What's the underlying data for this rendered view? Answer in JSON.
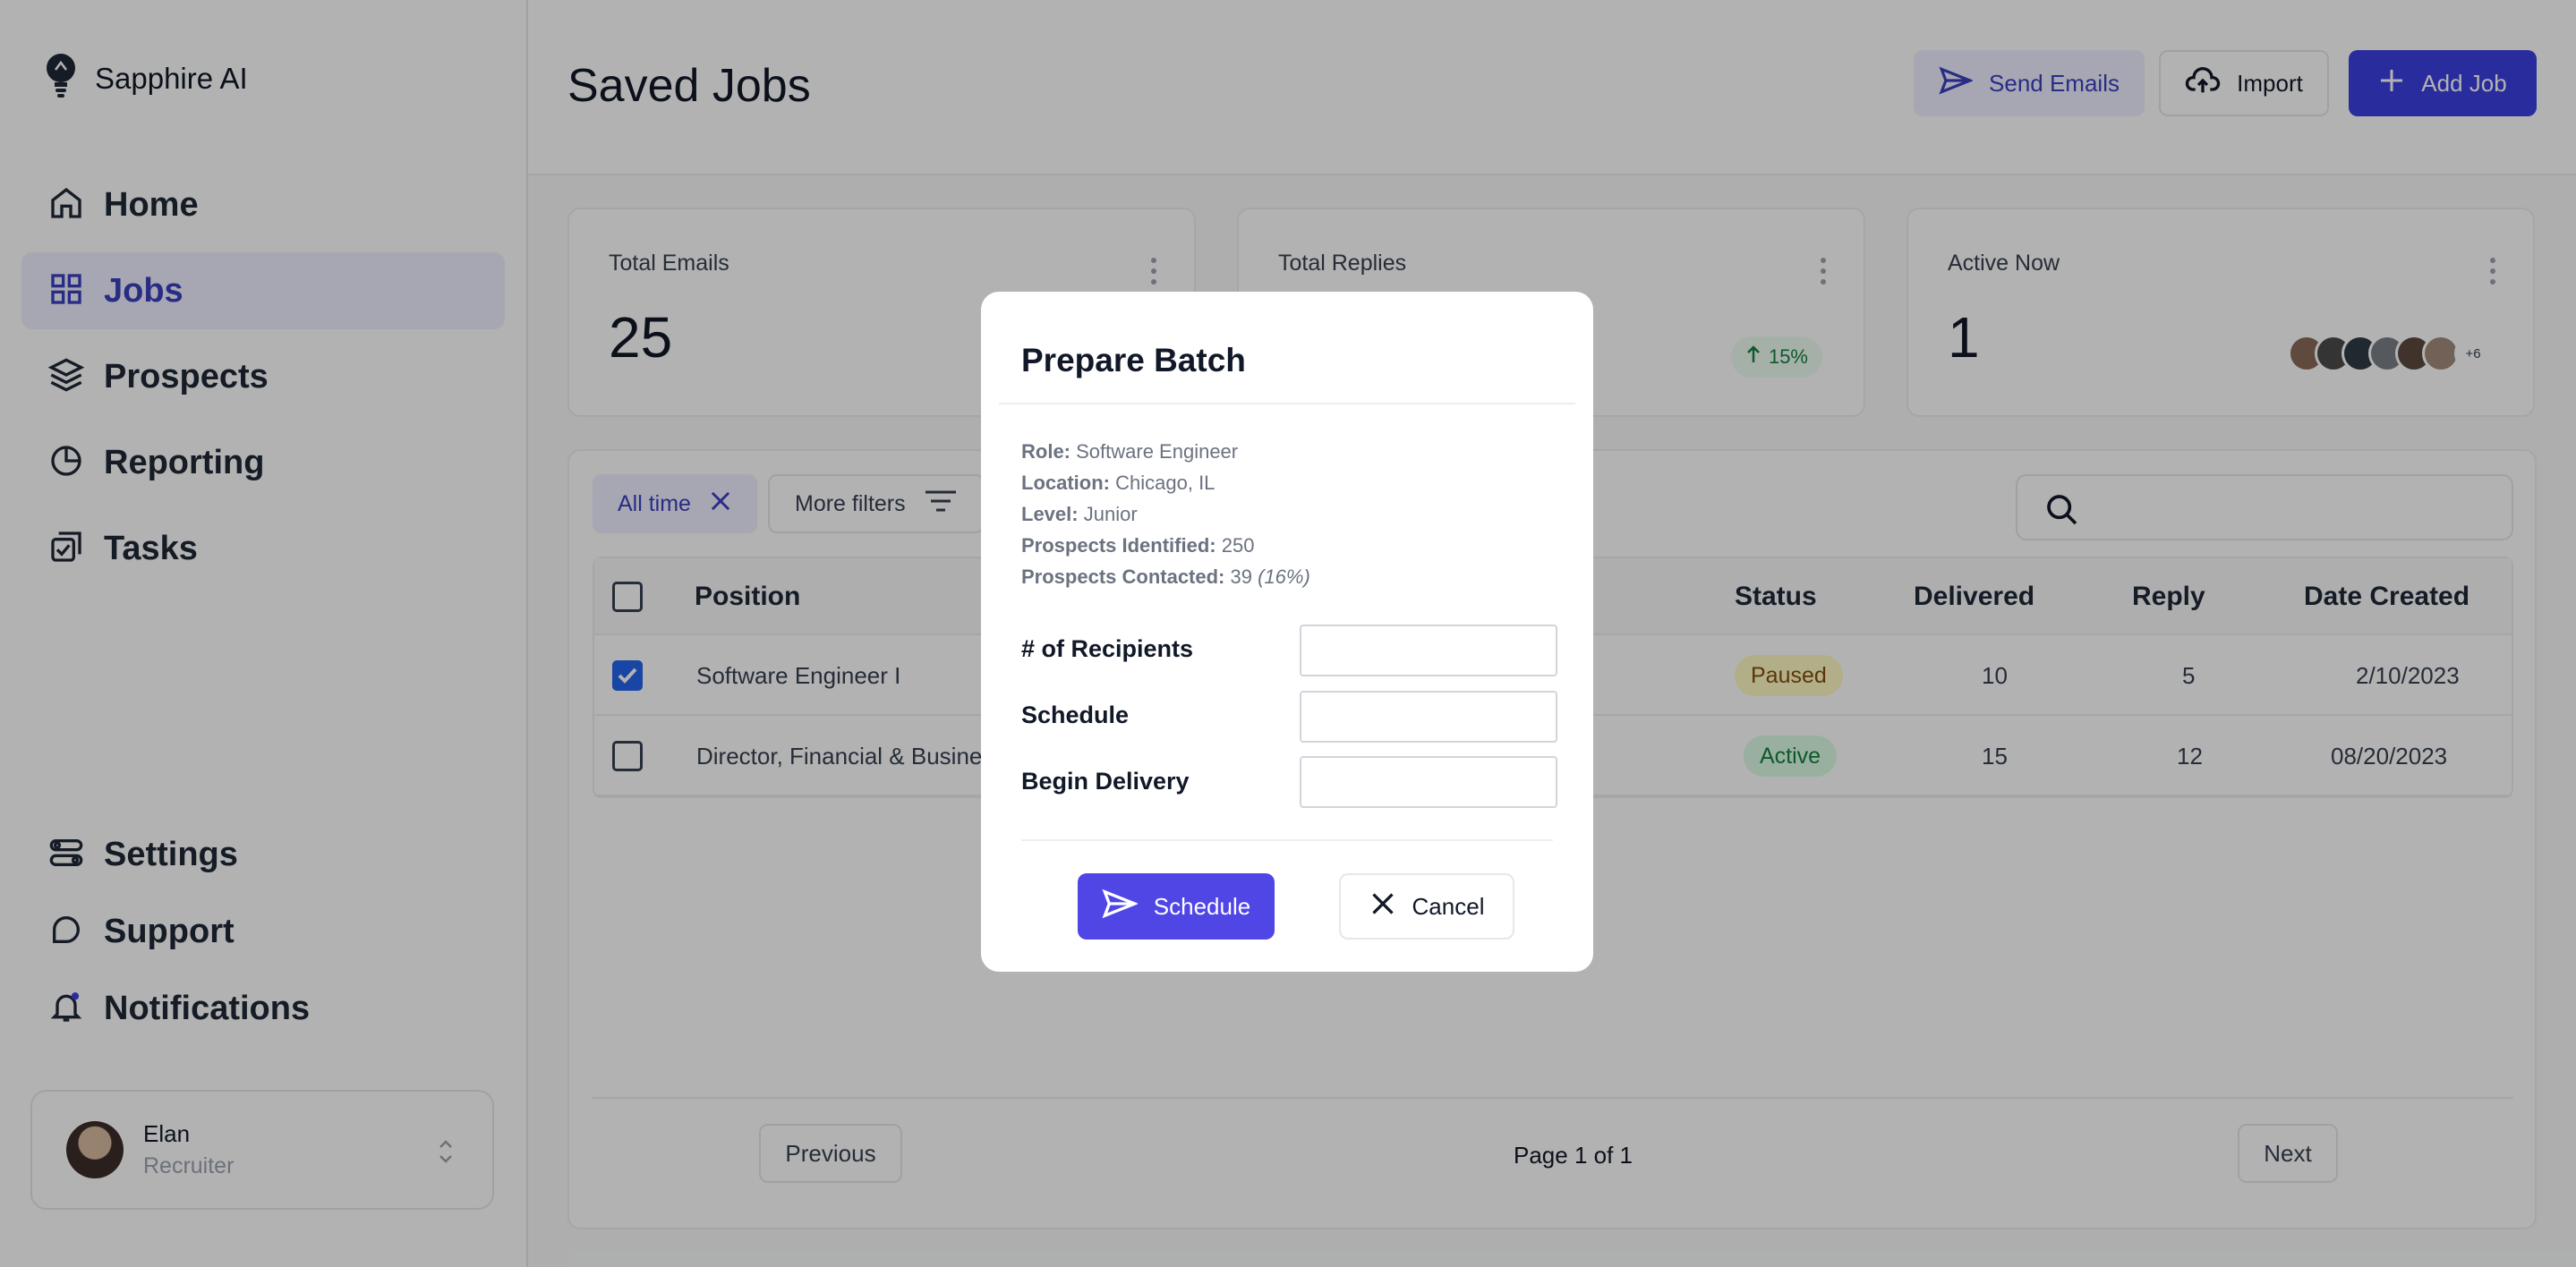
{
  "brand": {
    "name": "Sapphire AI"
  },
  "sidebar": {
    "items": [
      {
        "label": "Home",
        "icon": "home-icon"
      },
      {
        "label": "Jobs",
        "icon": "grid-icon",
        "active": true
      },
      {
        "label": "Prospects",
        "icon": "layers-icon"
      },
      {
        "label": "Reporting",
        "icon": "pie-chart-icon"
      },
      {
        "label": "Tasks",
        "icon": "tasks-icon"
      }
    ],
    "bottom_items": [
      {
        "label": "Settings",
        "icon": "settings-icon"
      },
      {
        "label": "Support",
        "icon": "support-icon"
      },
      {
        "label": "Notifications",
        "icon": "bell-icon"
      }
    ],
    "user": {
      "name": "Elan",
      "role": "Recruiter"
    }
  },
  "header": {
    "title": "Saved Jobs",
    "send_label": "Send Emails",
    "import_label": "Import",
    "add_label": "Add Job"
  },
  "stats": [
    {
      "label": "Total Emails",
      "value": "25"
    },
    {
      "label": "Total Replies",
      "value": "",
      "change": "15%"
    },
    {
      "label": "Active Now",
      "value": "1",
      "more": "+6"
    }
  ],
  "filters": {
    "time": "All time",
    "more": "More filters",
    "search_placeholder": ""
  },
  "table": {
    "headers": {
      "position": "Position",
      "status": "Status",
      "delivered": "Delivered",
      "reply": "Reply",
      "date": "Date Created"
    },
    "rows": [
      {
        "position": "Software Engineer I",
        "status": "Paused",
        "delivered": "10",
        "reply": "5",
        "date": "2/10/2023",
        "checked": true
      },
      {
        "position": "Director, Financial & Busines",
        "status": "Active",
        "delivered": "15",
        "reply": "12",
        "date": "08/20/2023",
        "checked": false
      }
    ]
  },
  "pagination": {
    "prev": "Previous",
    "info": "Page 1 of 1",
    "next": "Next"
  },
  "modal": {
    "title": "Prepare Batch",
    "role_label": "Role:",
    "role": "Software Engineer",
    "location_label": "Location:",
    "location": "Chicago, IL",
    "level_label": "Level:",
    "level": "Junior",
    "identified_label": "Prospects Identified:",
    "identified": "250",
    "contacted_label": "Prospects Contacted:",
    "contacted": "39",
    "contacted_pct": "(16%)",
    "recipients_label": "# of Recipients",
    "schedule_label": "Schedule",
    "begin_label": "Begin Delivery",
    "schedule_button": "Schedule",
    "cancel_button": "Cancel"
  },
  "colors": {
    "accent": "#3c3fe0",
    "primary_button": "#4f46e5",
    "overlay": "rgba(0,0,0,0.30)"
  }
}
